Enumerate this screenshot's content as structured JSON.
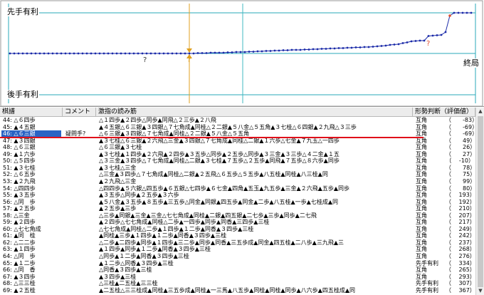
{
  "graph": {
    "label_top": "先手有利",
    "label_bottom": "後手有利",
    "label_end": "終局",
    "marker_qmarks": [
      "?",
      "?",
      "?"
    ],
    "colors": {
      "line": "#1a2aa8",
      "cursor": "#e0a020",
      "grid": "#40b8c0",
      "bad": "#e05030"
    }
  },
  "table": {
    "columns": [
      "棋譜",
      "コメント",
      "激指の読み筋",
      "形勢判断（評価値）"
    ],
    "rows": [
      {
        "move": "44: △６四歩",
        "comment": "",
        "pv": "△１四歩▲２四歩△同歩▲同飛△２三歩▲２八飛",
        "status": "互角",
        "eval": "（　　-83）"
      },
      {
        "move": "45: ▲４五銀",
        "comment": "",
        "pv": "▲４五銀△６三銀▲３四銀△７七角成▲同桂△２二銀▲５八金△５五角▲３七桂△６四銀▲２九飛△３三歩",
        "status": "互角",
        "eval": "（　　-69）"
      },
      {
        "move": "46: △６三銀",
        "comment": "疑問手?",
        "pv": "△６三銀▲３四銀△７七角成▲同桂△２二銀▲５八金△５五角",
        "status": "互角",
        "eval": "（　　-69）"
      },
      {
        "move": "47: ▲３四銀",
        "comment": "",
        "pv": "▲３七桂△６三銀▲２六飛△三金▲３四銀△７七角成▲同桂△二銀▲１六歩△七金▲７九玉△一四歩",
        "status": "互角",
        "eval": "（　　49）"
      },
      {
        "move": "48: △６三銀",
        "comment": "",
        "pv": "△６三銀▲３七桂",
        "status": "互角",
        "eval": "（　　26）"
      },
      {
        "move": "49: ▲１六歩",
        "comment": "",
        "pv": "▲３七桂▲１四歩▲２六飛▲２四歩▲３五歩△同歩▲２五歩△同歩▲３三金▲３三歩△４二金▲１五",
        "status": "互角",
        "eval": "（　　27）"
      },
      {
        "move": "50: △５四歩",
        "comment": "",
        "pv": "△３三金▲３四歩△７七角成▲同桂△二銀▲３七桂▲７五歩△２五歩▲同飛▲７五歩△８六歩▲同歩",
        "status": "互角",
        "eval": "（　 -10）"
      },
      {
        "move": "51: ▲３七桂",
        "comment": "",
        "pv": "▲３七桂△三金",
        "status": "互角",
        "eval": "（　　78）"
      },
      {
        "move": "52: △６五歩",
        "comment": "",
        "pv": "△三金▲３四歩△７七角成▲同桂△二銀▲２五飛△６五歩△５五歩▲八五桂▲同桂▲八三桂▲同",
        "status": "互角",
        "eval": "（　　75）"
      },
      {
        "move": "53: ▲２九飛",
        "comment": "",
        "pv": "▲２九飛△三金",
        "status": "互角",
        "eval": "（　　99）"
      },
      {
        "move": "54: △四四歩",
        "comment": "",
        "pv": "△四四歩▲５六銀△四五歩▲６五銀△七四歩▲６七金▲四角▲五玉▲九五歩▲三金▲２六飛▲五歩▲同歩",
        "status": "互角",
        "eval": "（　　80）"
      },
      {
        "move": "55: ▲３五歩",
        "comment": "",
        "pv": "▲３五歩△同歩▲２五歩▲３六歩",
        "status": "互角",
        "eval": "（　 193）"
      },
      {
        "move": "56: △同　歩",
        "comment": "",
        "pv": "▲５八金▲３五歩▲８五歩▲三五歩△同金▲同銀▲四五歩▲同金▲二歩▲八五桂▲一歩▲七桂成▲同",
        "status": "互角",
        "eval": "（　 192）"
      },
      {
        "move": "57: ▲２五歩",
        "comment": "",
        "pv": "▲２五歩▲三歩",
        "status": "互角",
        "eval": "（　 210）"
      },
      {
        "move": "58: △三金",
        "comment": "",
        "pv": "△三歩▲同銀▲三金▲三金△七七角成▲同桂▲二銀▲四五銀▲二七歩▲三歩▲同歩▲二七飛",
        "status": "互角",
        "eval": "（　 207）"
      },
      {
        "move": "59: ▲２四歩",
        "comment": "",
        "pv": "▲２四歩△七七角成▲同桂△二歩▲一四歩▲同歩▲同香▲三四歩▲三桂",
        "status": "互角",
        "eval": "（　 217）"
      },
      {
        "move": "60: △七七角成",
        "comment": "",
        "pv": "△七七角成▲同桂△二歩▲１四歩▲１二歩▲同香▲３四歩▲三桂",
        "status": "互角",
        "eval": "（　 249）"
      },
      {
        "move": "61: ▲同　桂",
        "comment": "",
        "pv": "▲同桂▲三歩▲１四歩▲１二歩▲同香▲３四歩▲三桂",
        "status": "互角",
        "eval": "（　 242）"
      },
      {
        "move": "62: △二二歩",
        "comment": "",
        "pv": "△二歩▲二四歩▲同歩▲１四歩▲三二歩▲同歩▲同香▲三五歩成▲同金▲四五桂▲二八歩▲三九飛▲三",
        "status": "互角",
        "eval": "（　 237）"
      },
      {
        "move": "63: ▲１四歩",
        "comment": "",
        "pv": "▲１四歩▲同歩▲１二歩▲同香▲３四歩▲三桂",
        "status": "互角",
        "eval": "（　 268）"
      },
      {
        "move": "64: △同　歩",
        "comment": "",
        "pv": "△同歩▲１二歩▲同香▲３四歩▲三桂",
        "status": "互角",
        "eval": "（　 276）"
      },
      {
        "move": "65: ▲１二歩",
        "comment": "",
        "pv": "▲１二歩△同香▲３四歩▲三桂",
        "status": "先手有利",
        "eval": "（　 334）"
      },
      {
        "move": "66: △同　香",
        "comment": "",
        "pv": "△同香▲３四歩▲三桂",
        "status": "互角",
        "eval": "（　 265）"
      },
      {
        "move": "67: ▲３四歩",
        "comment": "",
        "pv": "▲３四歩▲三桂",
        "status": "互角",
        "eval": "（　 293）"
      },
      {
        "move": "68: △三三桂",
        "comment": "",
        "pv": "△三桂▲二五桂▲三三桂",
        "status": "先手有利",
        "eval": "（　 307）"
      },
      {
        "move": "69: ▲２五桂",
        "comment": "",
        "pv": "▲二五桂△三三桂成▲同桂▲三五歩成▲同桂▲一三馬▲八五歩▲同桂▲同桂▲同歩▲八六歩▲四五桂成▲同",
        "status": "先手有利",
        "eval": "（　 367）"
      }
    ]
  }
}
